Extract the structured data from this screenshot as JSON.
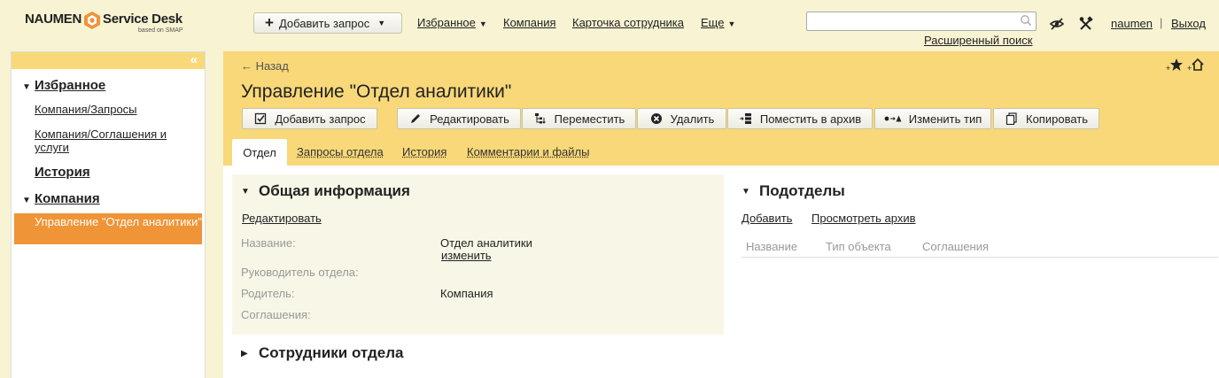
{
  "logo": {
    "brand": "NAUMEN",
    "product": "Service Desk",
    "tagline": "based on SMAP",
    "accent": "#ef9437"
  },
  "topbar": {
    "add_request": "Добавить запрос",
    "nav": {
      "favorites": "Избранное",
      "company": "Компания",
      "employee_card": "Карточка сотрудника",
      "more": "Еще"
    },
    "search_placeholder": "",
    "advanced_search": "Расширенный поиск",
    "user": "naumen",
    "logout": "Выход"
  },
  "sidebar": {
    "collapse_glyph": "«",
    "favorites": {
      "title": "Избранное",
      "items": [
        "Компания/Запросы",
        "Компания/Соглашения и услуги"
      ]
    },
    "history": "История",
    "company": {
      "title": "Компания",
      "active_item": "Управление \"Отдел аналитики\""
    }
  },
  "page": {
    "back": "← Назад",
    "title": "Управление \"Отдел аналитики\"",
    "toolbar": {
      "add_request": "Добавить запрос",
      "edit": "Редактировать",
      "move": "Переместить",
      "delete": "Удалить",
      "archive": "Поместить в архив",
      "change_type": "Изменить тип",
      "copy": "Копировать"
    },
    "tabs": [
      "Отдел",
      "Запросы отдела",
      "История",
      "Комментарии и файлы"
    ],
    "active_tab": 0
  },
  "general_info": {
    "title": "Общая информация",
    "edit_link": "Редактировать",
    "fields": {
      "name_label": "Название:",
      "name_value": "Отдел аналитики",
      "change_link": "изменить",
      "head_label": "Руководитель отдела:",
      "parent_label": "Родитель:",
      "parent_value": "Компания",
      "agreements_label": "Соглашения:"
    }
  },
  "subdivisions": {
    "title": "Подотделы",
    "add": "Добавить",
    "view_archive": "Просмотреть архив",
    "columns": [
      "Название",
      "Тип объекта",
      "Соглашения"
    ]
  },
  "employees": {
    "title": "Сотрудники отдела"
  },
  "colors": {
    "header_bg": "#f8d878",
    "topbar_bg": "#f7f3d3",
    "active_item": "#ef9437",
    "info_bg": "#f8f7e7"
  }
}
